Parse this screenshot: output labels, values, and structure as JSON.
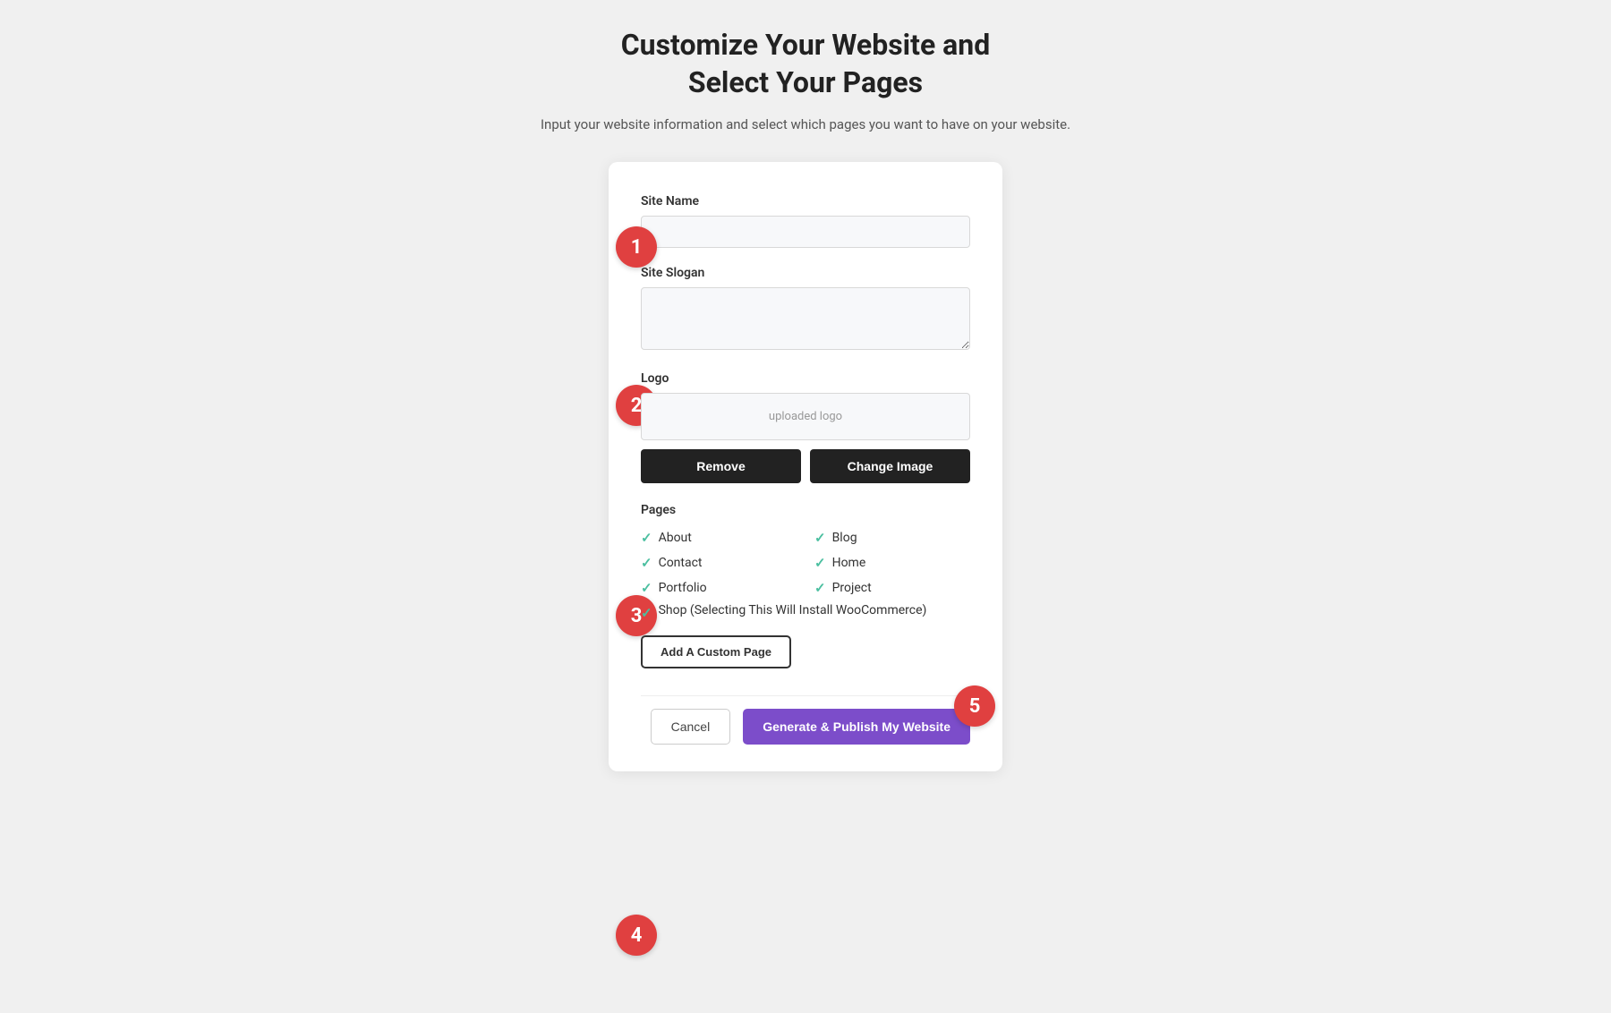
{
  "header": {
    "title_line1": "Customize Your Website and",
    "title_line2": "Select Your Pages",
    "subtitle": "Input your website information and select which pages you want to have on your website."
  },
  "steps": {
    "step1": "1",
    "step2": "2",
    "step3": "3",
    "step4": "4",
    "step5": "5"
  },
  "form": {
    "site_name_label": "Site Name",
    "site_name_placeholder": "",
    "site_slogan_label": "Site Slogan",
    "site_slogan_placeholder": "",
    "logo_label": "Logo",
    "logo_preview_text": "uploaded logo",
    "remove_button": "Remove",
    "change_image_button": "Change Image",
    "pages_label": "Pages",
    "pages": [
      {
        "label": "About",
        "checked": true
      },
      {
        "label": "Blog",
        "checked": true
      },
      {
        "label": "Contact",
        "checked": true
      },
      {
        "label": "Home",
        "checked": true
      },
      {
        "label": "Portfolio",
        "checked": true
      },
      {
        "label": "Project",
        "checked": true
      }
    ],
    "shop_page_label": "Shop (Selecting This Will Install WooCommerce)",
    "shop_checked": true,
    "add_custom_page_button": "Add A Custom Page",
    "cancel_button": "Cancel",
    "publish_button": "Generate & Publish My Website"
  },
  "colors": {
    "step_bubble": "#e04040",
    "publish_button": "#7c4dca",
    "check_color": "#4bbfa0"
  }
}
